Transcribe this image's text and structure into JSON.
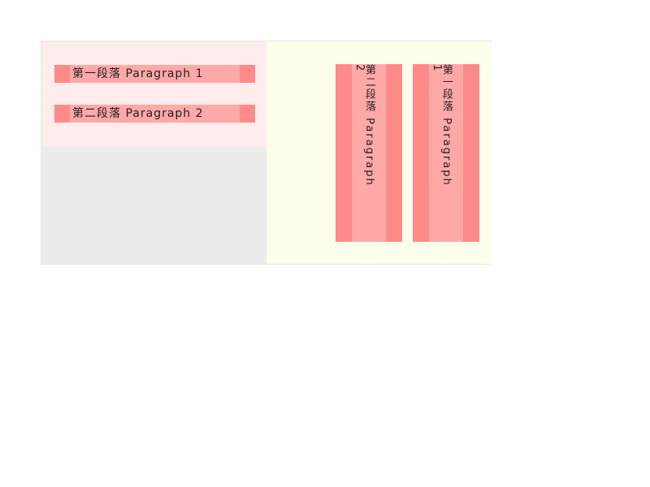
{
  "horizontal": {
    "paragraph1": "第一段落 Paragraph 1",
    "paragraph2": "第二段落 Paragraph 2"
  },
  "vertical": {
    "column1_number": "1",
    "column1_text": "第一段落 Paragraph",
    "column2_number": "2",
    "column2_text": "第二段落 Paragraph"
  },
  "colors": {
    "line_outer": "#ff8a8a",
    "line_inner": "#ffa8a8",
    "left_top_bg": "#ffecec",
    "left_bottom_bg": "#ececec",
    "right_bg": "#fcffea"
  }
}
